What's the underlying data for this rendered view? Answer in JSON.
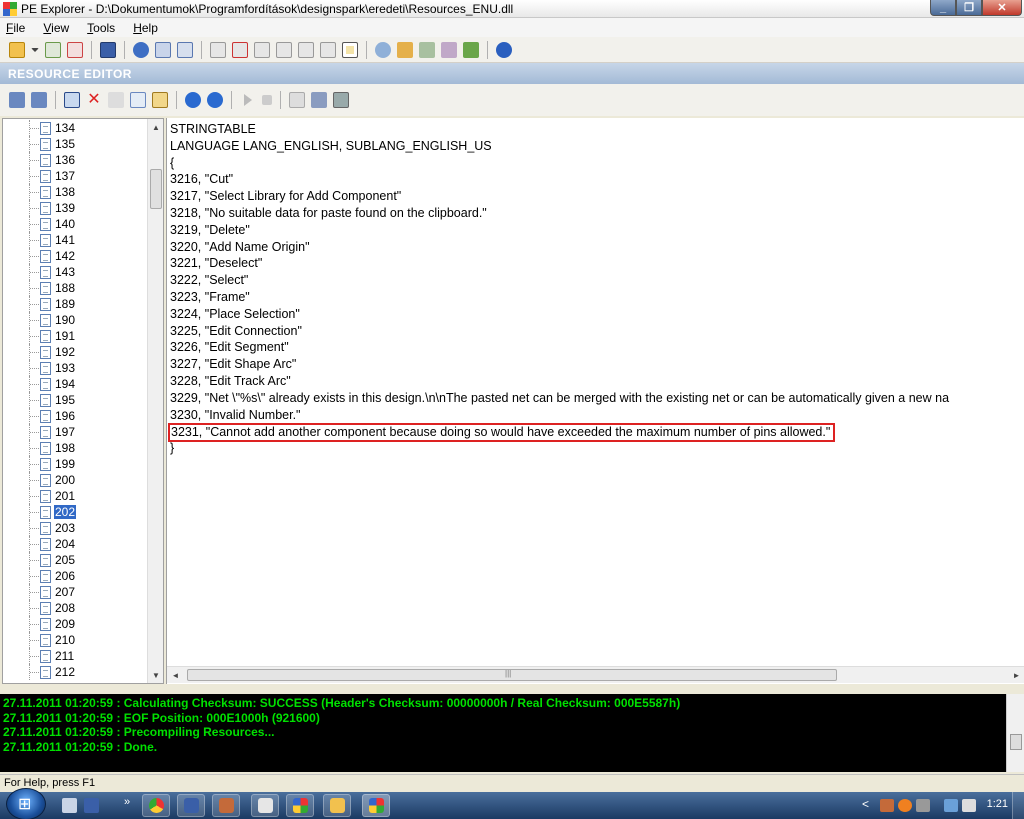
{
  "window": {
    "title": "PE Explorer - D:\\Dokumentumok\\Programfordítások\\designspark\\eredeti\\Resources_ENU.dll",
    "min": "_",
    "max": "❐",
    "close": "✕"
  },
  "menu": {
    "items": [
      {
        "first": "F",
        "rest": "ile"
      },
      {
        "first": "V",
        "rest": "iew"
      },
      {
        "first": "T",
        "rest": "ools"
      },
      {
        "first": "H",
        "rest": "elp"
      }
    ]
  },
  "panel": {
    "header": "RESOURCE EDITOR"
  },
  "tree": {
    "items": [
      "134",
      "135",
      "136",
      "137",
      "138",
      "139",
      "140",
      "141",
      "142",
      "143",
      "188",
      "189",
      "190",
      "191",
      "192",
      "193",
      "194",
      "195",
      "196",
      "197",
      "198",
      "199",
      "200",
      "201",
      "202",
      "203",
      "204",
      "205",
      "206",
      "207",
      "208",
      "209",
      "210",
      "211",
      "212"
    ],
    "selected": "202",
    "scroll_up": "▲",
    "scroll_down": "▼"
  },
  "editor": {
    "lines": [
      "STRINGTABLE",
      "LANGUAGE LANG_ENGLISH, SUBLANG_ENGLISH_US",
      "{",
      "3216, \"Cut\"",
      "3217, \"Select Library for Add Component\"",
      "3218, \"No suitable data for paste found on the clipboard.\"",
      "3219, \"Delete\"",
      "3220, \"Add Name Origin\"",
      "3221, \"Deselect\"",
      "3222, \"Select\"",
      "3223, \"Frame\"",
      "3224, \"Place Selection\"",
      "3225, \"Edit Connection\"",
      "3226, \"Edit Segment\"",
      "3227, \"Edit Shape Arc\"",
      "3228, \"Edit Track Arc\"",
      "3229, \"Net \\\"%s\\\" already exists in this design.\\n\\nThe pasted net can be merged with the existing net or can be automatically given a new na",
      "3230, \"Invalid Number.\"",
      "3231, \"Cannot add another component because doing so would have exceeded the maximum number of pins allowed.\"",
      "}"
    ],
    "highlight_index": 18,
    "highlight_color": "#dd2222",
    "scroll_left": "◄",
    "scroll_right": "►",
    "grip": "|||"
  },
  "log": {
    "text_color": "#00e000",
    "lines": [
      "27.11.2011 01:20:59 : Calculating Checksum: SUCCESS (Header's Checksum: 00000000h / Real Checksum: 000E5587h)",
      "27.11.2011 01:20:59 : EOF Position: 000E1000h  (921600)",
      "27.11.2011 01:20:59 : Precompiling Resources...",
      "27.11.2011 01:20:59 : Done."
    ]
  },
  "status": {
    "text": "For Help, press F1"
  },
  "taskbar": {
    "clock": "1:21",
    "overflow": "»",
    "tray_chevron": "<"
  }
}
